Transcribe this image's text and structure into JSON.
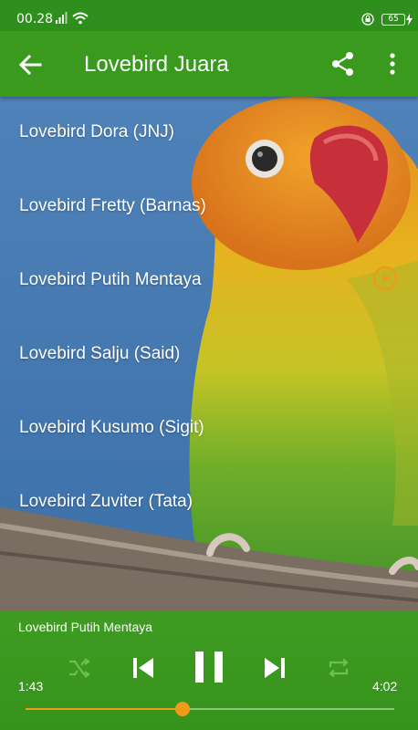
{
  "status_bar": {
    "time": "00.28",
    "battery": "65"
  },
  "app_bar": {
    "title": "Lovebird Juara"
  },
  "songs": [
    {
      "title": "Lovebird Dora (JNJ)",
      "playing": false
    },
    {
      "title": "Lovebird Fretty (Barnas)",
      "playing": false
    },
    {
      "title": "Lovebird Putih Mentaya",
      "playing": true
    },
    {
      "title": "Lovebird Salju (Said)",
      "playing": false
    },
    {
      "title": "Lovebird Kusumo (Sigit)",
      "playing": false
    },
    {
      "title": "Lovebird Zuviter (Tata)",
      "playing": false
    }
  ],
  "player": {
    "now_playing": "Lovebird Putih Mentaya",
    "elapsed": "1:43",
    "total": "4:02",
    "progress": 0.426
  },
  "colors": {
    "app_bar": "#3a9a1e",
    "accent": "#f09a1a"
  }
}
